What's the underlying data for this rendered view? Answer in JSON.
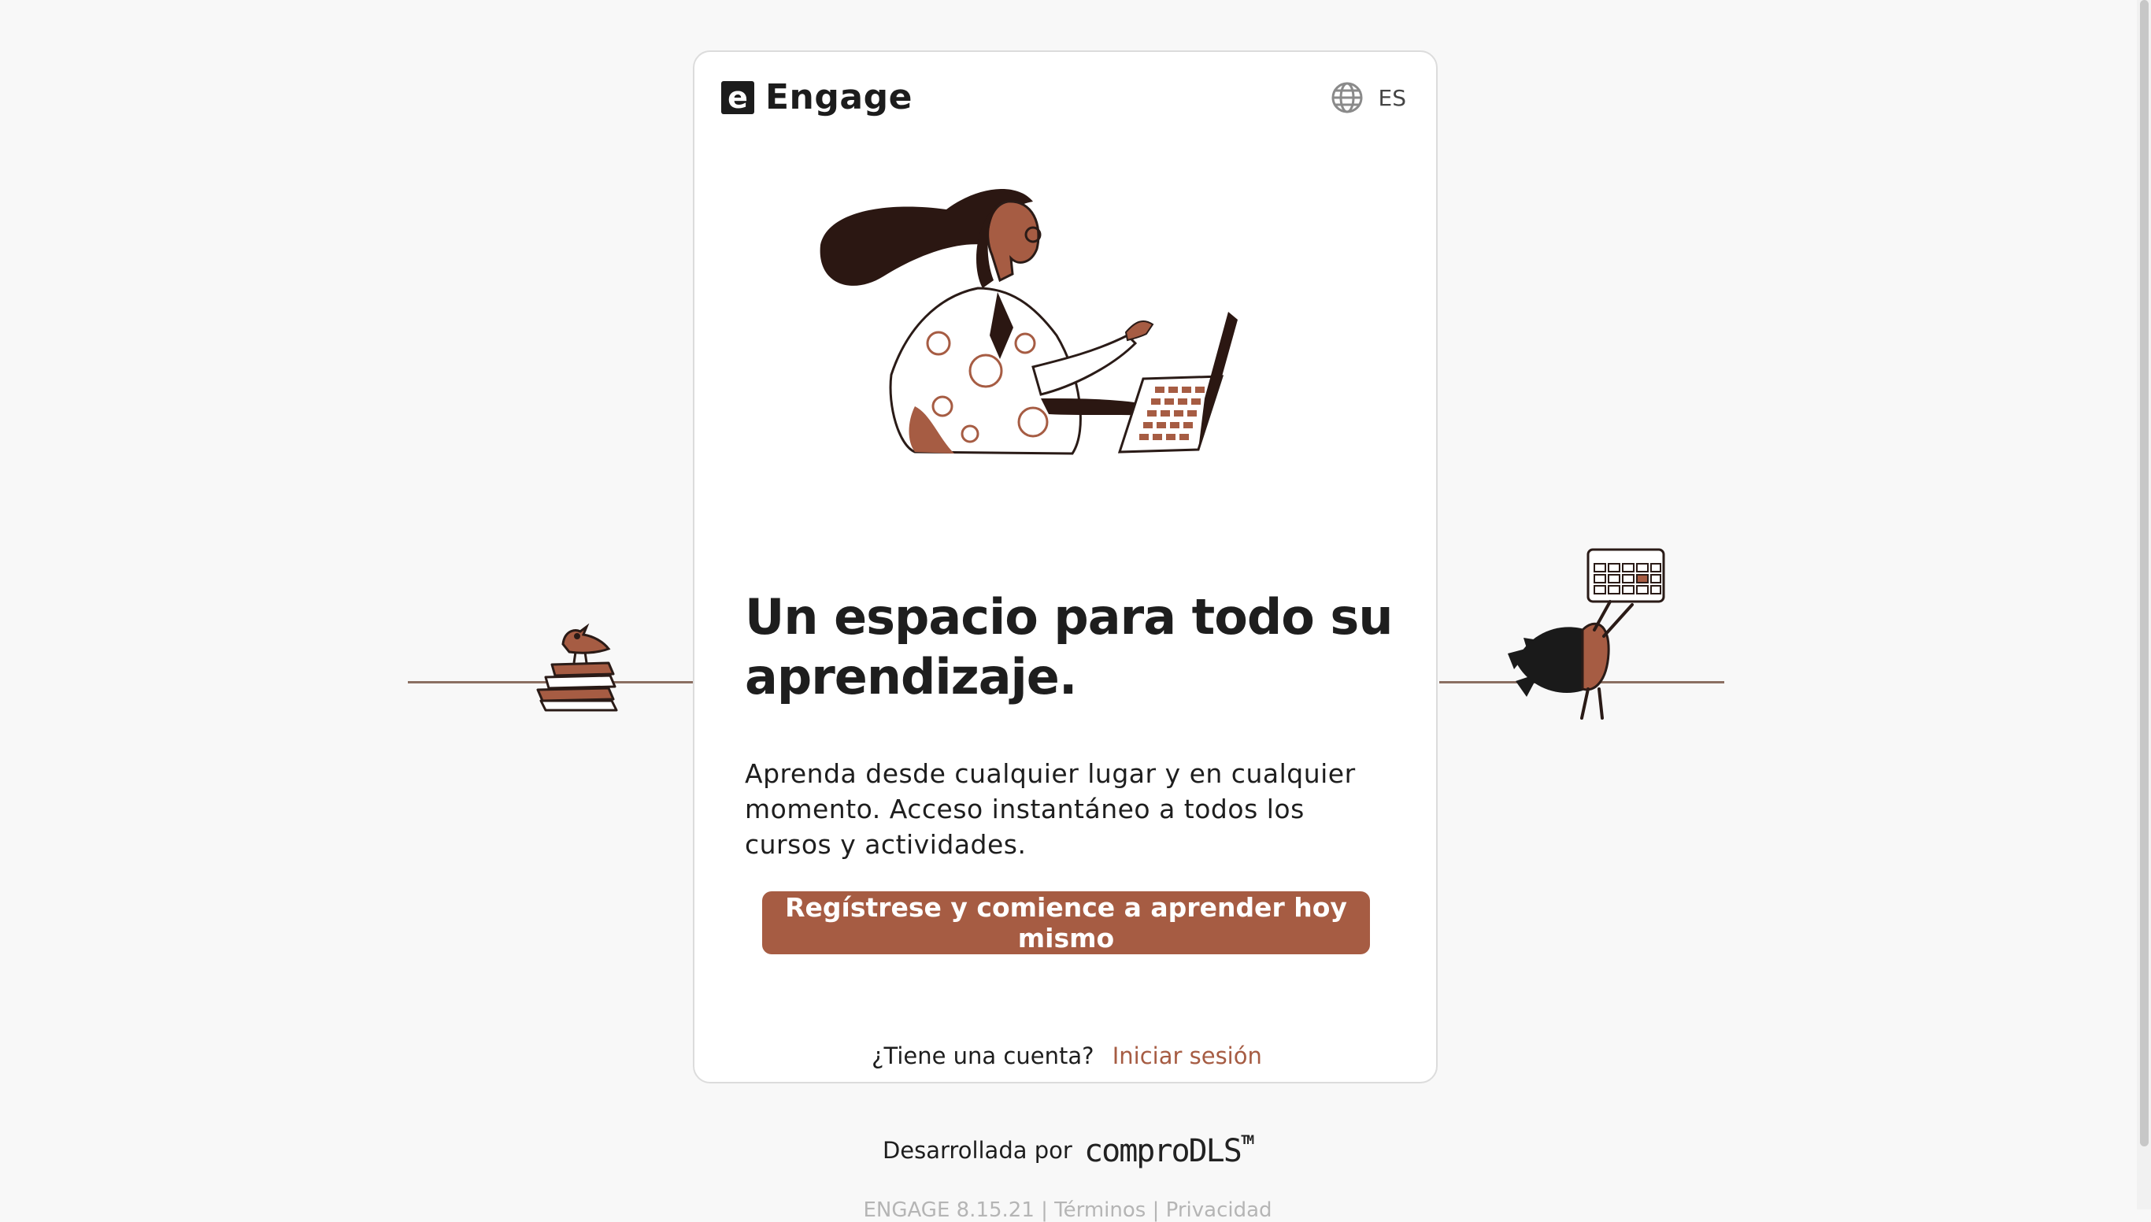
{
  "brand": {
    "mark_letter": "e",
    "name": "Engage"
  },
  "language": {
    "icon": "globe-icon",
    "code": "ES"
  },
  "hero": {
    "headline": "Un espacio para todo su aprendizaje.",
    "description": "Aprenda desde cualquier lugar y en cualquier momento. Acceso instantáneo a todos los cursos y actividades."
  },
  "cta": {
    "signup_label": "Regístrese y comience a aprender hoy mismo"
  },
  "login": {
    "prompt": "¿Tiene una cuenta?",
    "link_label": "Iniciar sesión"
  },
  "footer": {
    "developed_by": "Desarrollada por",
    "company": "comproDLS",
    "trademark": "TM",
    "version_partial": "ENGAGE 8.15.21 | Términos | Privacidad"
  },
  "colors": {
    "accent": "#a65c43",
    "dark": "#1c1c1c",
    "background": "#f8f8f8"
  }
}
